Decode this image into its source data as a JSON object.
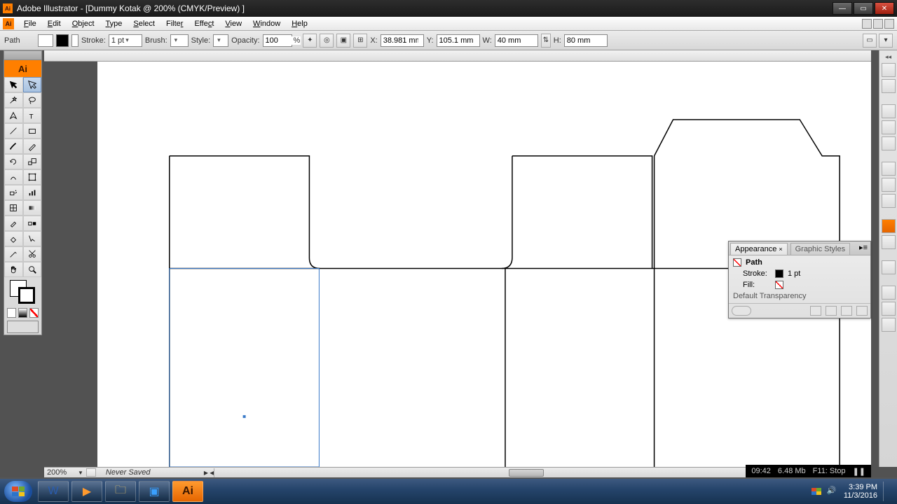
{
  "title": "Adobe Illustrator - [Dummy Kotak @ 200% (CMYK/Preview) ]",
  "menus": [
    "File",
    "Edit",
    "Object",
    "Type",
    "Select",
    "Filter",
    "Effect",
    "View",
    "Window",
    "Help"
  ],
  "control": {
    "sel_label": "Path",
    "stroke_label": "Stroke:",
    "stroke_val": "1 pt",
    "brush_label": "Brush:",
    "style_label": "Style:",
    "opacity_label": "Opacity:",
    "opacity_val": "100",
    "opacity_unit": "%",
    "x_label": "X:",
    "x_val": "38.981 mm",
    "y_label": "Y:",
    "y_val": "105.1 mm",
    "w_label": "W:",
    "w_val": "40 mm",
    "h_label": "H:",
    "h_val": "80 mm"
  },
  "panel": {
    "tab1": "Appearance",
    "tab2": "Graphic Styles",
    "obj": "Path",
    "stroke_lbl": "Stroke:",
    "stroke_val": "1 pt",
    "fill_lbl": "Fill:",
    "trans": "Default Transparency"
  },
  "doc_footer": {
    "zoom": "200%",
    "status": "Never Saved"
  },
  "rec": {
    "time": "09:42",
    "size": "6.48 Mb",
    "stop": "F11: Stop",
    "pause": "❚❚"
  },
  "taskbar": {
    "time": "3:39 PM",
    "date": "11/3/2016"
  }
}
